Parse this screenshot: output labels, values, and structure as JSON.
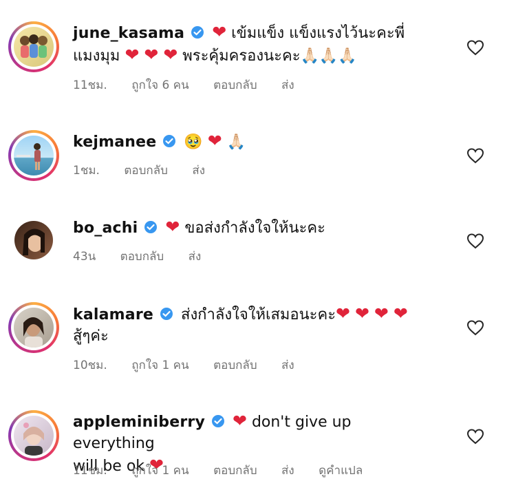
{
  "comments": [
    {
      "username": "june_kasama",
      "text_line1": "เข้มแข็ง แข็งแรงไว้นะคะพี่",
      "text_line2": "แมงมุม",
      "text_line2b": "พระคุ้มครองนะคะ",
      "prayer": "🙏🏻🙏🏻🙏🏻",
      "time": "11ชม.",
      "likes": "ถูกใจ 6 คน",
      "reply": "ตอบกลับ",
      "send": "ส่ง"
    },
    {
      "username": "kejmanee",
      "emoji": "🥹",
      "prayer": "🙏🏻",
      "time": "1ชม.",
      "reply": "ตอบกลับ",
      "send": "ส่ง"
    },
    {
      "username": "bo_achi",
      "text": "ขอส่งกำลังใจให้นะคะ",
      "time": "43น",
      "reply": "ตอบกลับ",
      "send": "ส่ง"
    },
    {
      "username": "kalamare",
      "text_line1": "ส่งกำลังใจให้เสมอนะคะ",
      "text_line2": "สู้ๆค่ะ",
      "time": "10ชม.",
      "likes": "ถูกใจ 1 คน",
      "reply": "ตอบกลับ",
      "send": "ส่ง"
    },
    {
      "username": "appleminiberry",
      "text_line1": "don't give up everything",
      "text_line2": "will be ok",
      "time": "11ชม.",
      "likes": "ถูกใจ 1 คน",
      "reply": "ตอบกลับ",
      "send": "ส่ง",
      "translate": "ดูคำแปล"
    }
  ],
  "icons": {
    "heart": "❤",
    "verified": "verified-badge-icon",
    "like": "heart-outline-icon"
  },
  "colors": {
    "verified": "#3897f0",
    "heart": "#e0243a",
    "meta": "#737373"
  }
}
